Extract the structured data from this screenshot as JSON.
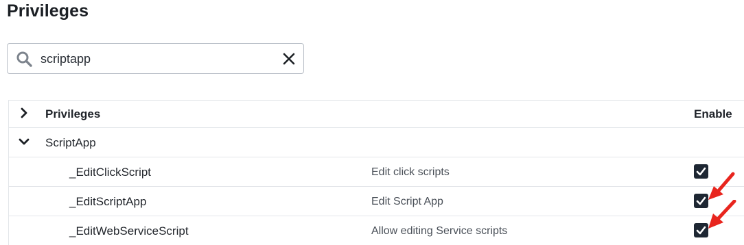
{
  "page": {
    "title": "Privileges"
  },
  "search": {
    "value": "scriptapp",
    "placeholder": ""
  },
  "tree": {
    "header": {
      "name_label": "Privileges",
      "enable_label": "Enable"
    },
    "group": {
      "name": "ScriptApp",
      "expanded": true
    },
    "rows": [
      {
        "name": "_EditClickScript",
        "description": "Edit click scripts",
        "enabled": true
      },
      {
        "name": "_EditScriptApp",
        "description": "Edit Script App",
        "enabled": true
      },
      {
        "name": "_EditWebServiceScript",
        "description": "Allow editing Service scripts",
        "enabled": true
      }
    ]
  },
  "colors": {
    "checkbox": "#1e2733",
    "annotation_arrow": "#e8251e",
    "border": "#e3e6ea"
  }
}
